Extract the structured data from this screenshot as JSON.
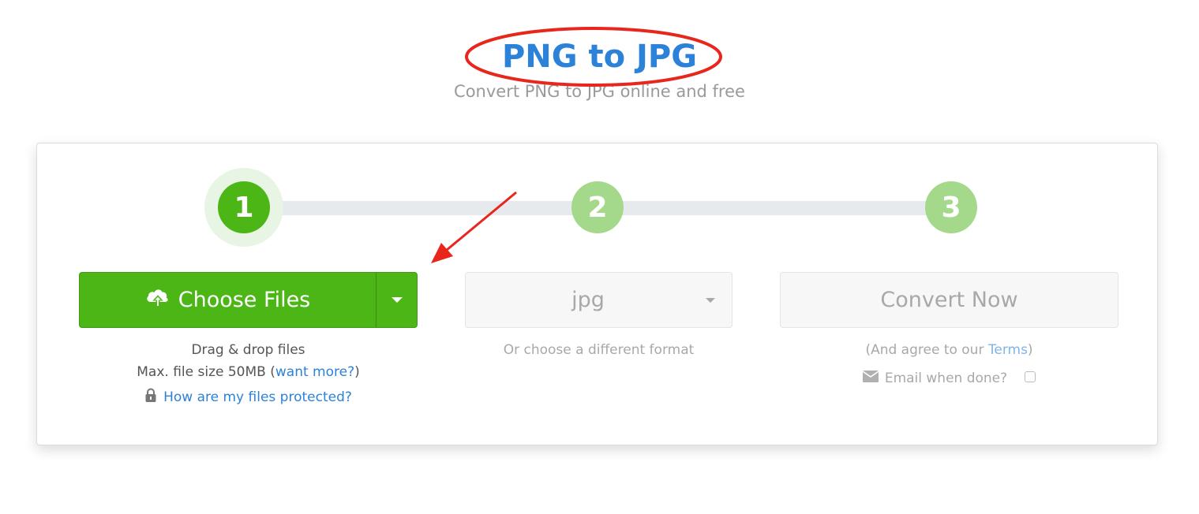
{
  "header": {
    "title": "PNG to JPG",
    "subtitle": "Convert PNG to JPG online and free"
  },
  "steps": [
    "1",
    "2",
    "3"
  ],
  "upload": {
    "button_label": "Choose Files",
    "icon": "cloud-upload-icon",
    "dropdown_icon": "caret-down-icon",
    "drag_text": "Drag & drop files",
    "max_size_prefix": "Max. file size 50MB (",
    "max_size_link": "want more?",
    "max_size_suffix": ")",
    "protect_icon": "lock-icon",
    "protect_link": "How are my files protected?"
  },
  "format": {
    "selected": "jpg",
    "hint": "Or choose a different format"
  },
  "convert": {
    "button_label": "Convert Now",
    "agree_prefix": "(And agree to our ",
    "agree_link": "Terms",
    "agree_suffix": ")",
    "email_icon": "envelope-icon",
    "email_label": "Email when done?",
    "email_checked": false
  },
  "colors": {
    "primary_green": "#4cb617",
    "step_inactive": "#a4d98c",
    "title_blue": "#2c82d9",
    "annotation_red": "#e8261c"
  }
}
